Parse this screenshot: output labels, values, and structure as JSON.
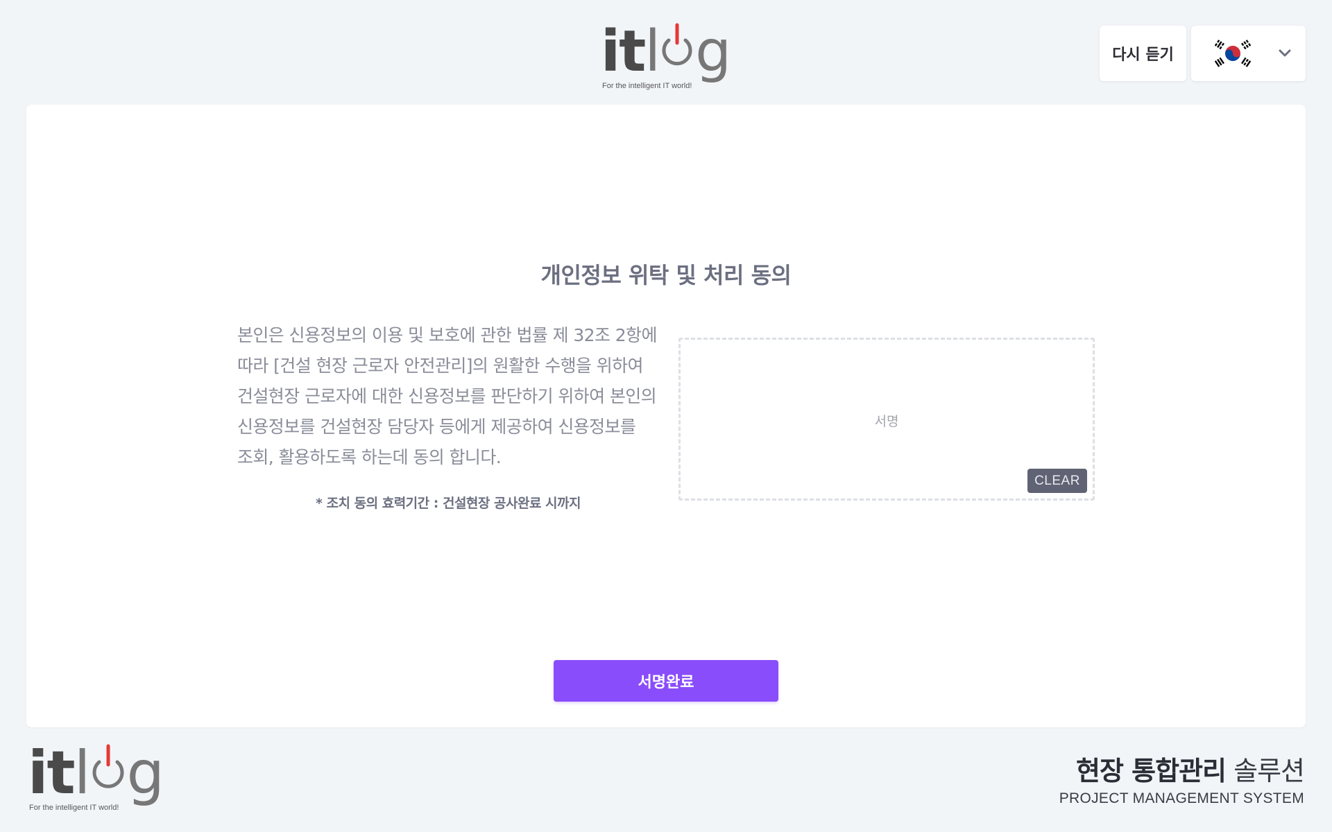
{
  "header": {
    "logo": {
      "bold": "it",
      "thin_l": "l",
      "thin_g": "g",
      "tagline": "For the intelligent IT world!"
    },
    "replay_label": "다시 듣기",
    "language_icon": "korea-flag-icon"
  },
  "main": {
    "title": "개인정보 위탁 및 처리 동의",
    "consent_text": "본인은 신용정보의 이용 및 보호에 관한 법률 제 32조 2항에 따라 [건설 현장 근로자 안전관리]의 원활한 수행을 위하여 건설현장 근로자에 대한 신용정보를 판단하기 위하여 본인의 신용정보를 건설현장 담당자 등에게 제공하여 신용정보를 조회, 활용하도록 하는데 동의 합니다.",
    "validity_note": "* 조치 동의 효력기간 : 건설현장 공사완료 시까지",
    "signature_placeholder": "서명",
    "clear_label": "CLEAR",
    "submit_label": "서명완료"
  },
  "footer": {
    "logo": {
      "bold": "it",
      "thin_l": "l",
      "thin_g": "g",
      "tagline": "For the intelligent IT world!"
    },
    "title_bold": "현장 통합관리",
    "title_light": "솔루션",
    "subtitle": "PROJECT MANAGEMENT SYSTEM"
  },
  "colors": {
    "accent": "#8a4dfb",
    "logo_red": "#e53935",
    "background": "#f2f5f8"
  }
}
